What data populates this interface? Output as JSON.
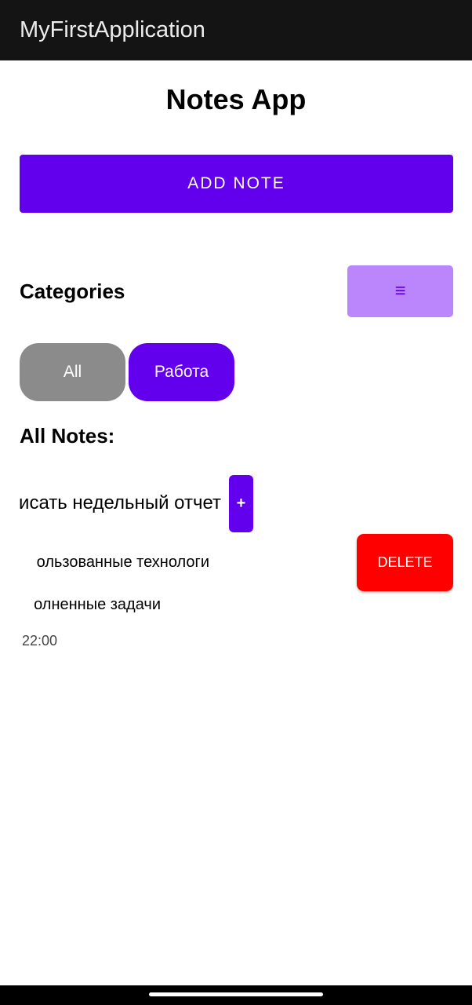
{
  "app_bar": {
    "title": "MyFirstApplication"
  },
  "header": {
    "title": "Notes App"
  },
  "actions": {
    "add_note_label": "ADD NOTE"
  },
  "categories": {
    "label": "Categories",
    "menu_icon": "menu-icon",
    "menu_glyph": "≡",
    "chips": [
      {
        "label": "All",
        "color": "#8b8b8b"
      },
      {
        "label": "Работа",
        "color": "#6200ee"
      }
    ]
  },
  "notes": {
    "label": "All Notes:",
    "items": [
      {
        "title": "исать недельный отчет",
        "line1": "ользованные технологи",
        "line2": "олненные задачи",
        "time": "22:00",
        "add_label": "+",
        "delete_label": "DELETE"
      }
    ]
  },
  "colors": {
    "primary": "#6200ee",
    "primary_light": "#bb86fc",
    "delete": "#ff0000",
    "appbar": "#141414"
  }
}
